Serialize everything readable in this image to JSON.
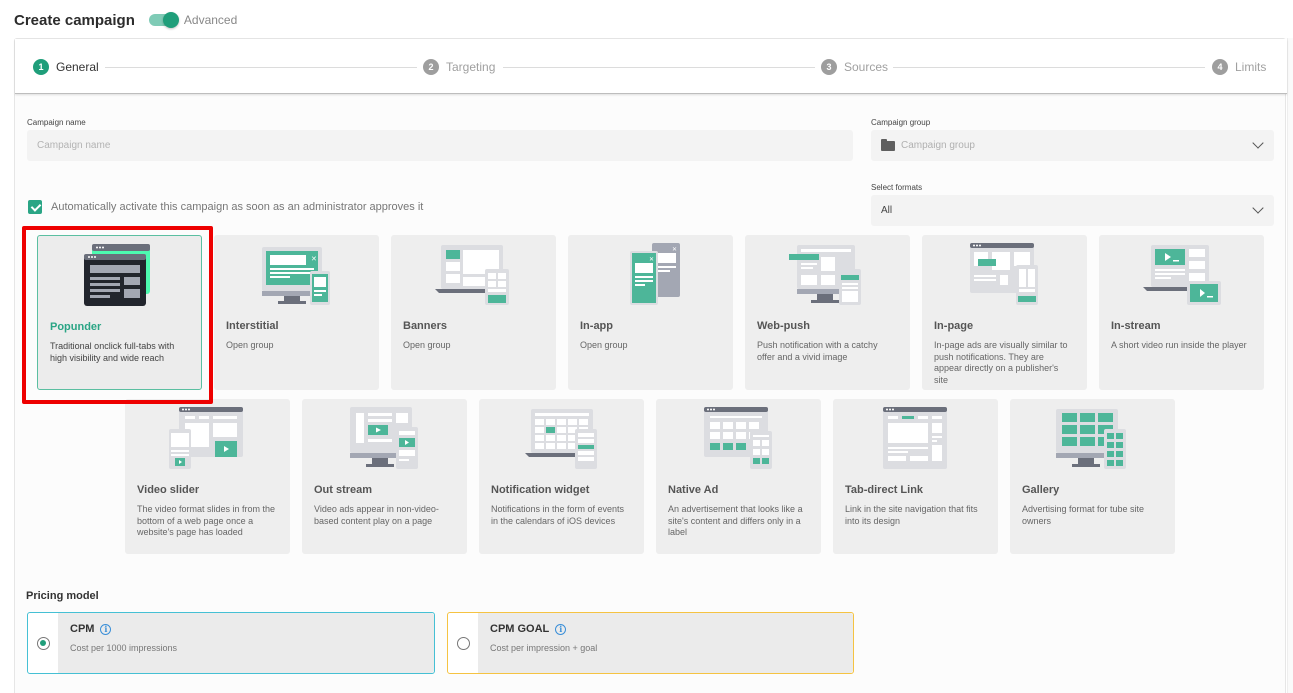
{
  "header": {
    "title": "Create campaign",
    "toggle_label": "Advanced",
    "toggle_on": true
  },
  "colors": {
    "accent": "#1f9e7a",
    "tile_bg": "#eeeeee",
    "highlight": "#ee0000",
    "cpm_border": "#45c0d4",
    "cpm_goal_border": "#f5c342",
    "info": "#3a8fd8"
  },
  "stepper": {
    "steps": [
      {
        "num": "1",
        "label": "General",
        "active": true
      },
      {
        "num": "2",
        "label": "Targeting",
        "active": false
      },
      {
        "num": "3",
        "label": "Sources",
        "active": false
      },
      {
        "num": "4",
        "label": "Limits",
        "active": false
      }
    ]
  },
  "form": {
    "campaign_name": {
      "label": "Campaign name",
      "placeholder": "Campaign name",
      "value": ""
    },
    "campaign_group": {
      "label": "Campaign group",
      "placeholder": "Campaign group",
      "icon": "folder-icon"
    },
    "select_formats": {
      "label": "Select formats",
      "value": "All"
    },
    "auto_activate": {
      "label": "Automatically activate this campaign as soon as an administrator approves it",
      "checked": true
    }
  },
  "formats": [
    {
      "id": "popunder",
      "title": "Popunder",
      "desc": "Traditional onclick full-tabs with high visibility and wide reach",
      "selected": true,
      "icon": "popunder-icon"
    },
    {
      "id": "interstitial",
      "title": "Interstitial",
      "desc": "Open group",
      "selected": false,
      "icon": "interstitial-icon"
    },
    {
      "id": "banners",
      "title": "Banners",
      "desc": "Open group",
      "selected": false,
      "icon": "banners-icon"
    },
    {
      "id": "in-app",
      "title": "In-app",
      "desc": "Open group",
      "selected": false,
      "icon": "in-app-icon"
    },
    {
      "id": "web-push",
      "title": "Web-push",
      "desc": "Push notification with a catchy offer and a vivid image",
      "selected": false,
      "icon": "web-push-icon"
    },
    {
      "id": "in-page",
      "title": "In-page",
      "desc": "In-page ads are visually similar to push notifications. They are appear directly on a publisher's site",
      "selected": false,
      "icon": "in-page-icon"
    },
    {
      "id": "in-stream",
      "title": "In-stream",
      "desc": "A short video run inside the player",
      "selected": false,
      "icon": "in-stream-icon"
    },
    {
      "id": "video-slider",
      "title": "Video slider",
      "desc": "The video format slides in from the bottom of a web page once a website's page has loaded",
      "selected": false,
      "icon": "video-slider-icon"
    },
    {
      "id": "out-stream",
      "title": "Out stream",
      "desc": "Video ads appear in non-video-based content play on a page",
      "selected": false,
      "icon": "out-stream-icon"
    },
    {
      "id": "notification-widget",
      "title": "Notification widget",
      "desc": "Notifications in the form of events in the calendars of iOS devices",
      "selected": false,
      "icon": "notification-widget-icon"
    },
    {
      "id": "native-ad",
      "title": "Native Ad",
      "desc": "An advertisement that looks like a site's content and differs only in a label",
      "selected": false,
      "icon": "native-ad-icon"
    },
    {
      "id": "tab-direct-link",
      "title": "Tab-direct Link",
      "desc": "Link in the site navigation that fits into its design",
      "selected": false,
      "icon": "tab-direct-link-icon"
    },
    {
      "id": "gallery",
      "title": "Gallery",
      "desc": "Advertising format for tube site owners",
      "selected": false,
      "icon": "gallery-icon"
    }
  ],
  "pricing": {
    "title": "Pricing model",
    "options": [
      {
        "id": "cpm",
        "title": "CPM",
        "desc": "Cost per 1000 impressions",
        "checked": true
      },
      {
        "id": "cpm-goal",
        "title": "CPM GOAL",
        "desc": "Cost per impression + goal",
        "checked": false
      }
    ]
  }
}
